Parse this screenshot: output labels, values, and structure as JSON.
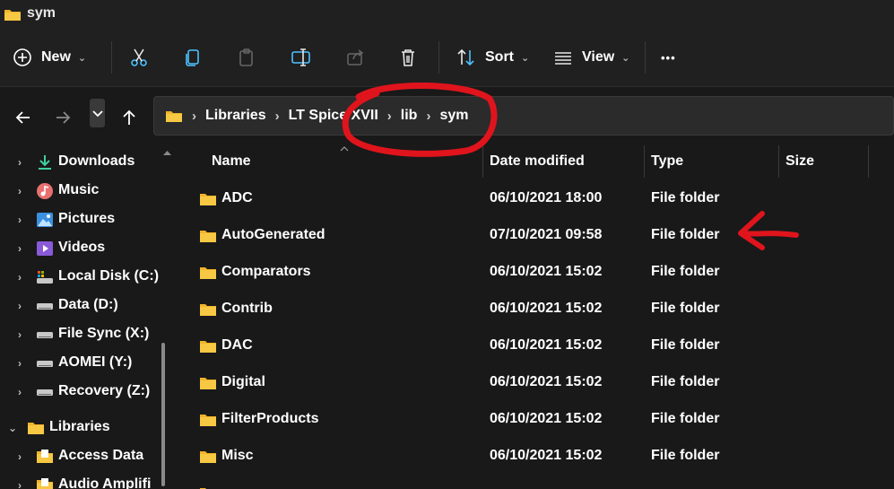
{
  "window": {
    "title": "sym"
  },
  "toolbar": {
    "new_label": "New",
    "sort_label": "Sort",
    "view_label": "View",
    "more_label": "•••"
  },
  "breadcrumb": {
    "items": [
      "Libraries",
      "LT Spice XVII",
      "lib",
      "sym"
    ]
  },
  "sidebar": {
    "items": [
      {
        "label": "Downloads",
        "icon": "download-icon"
      },
      {
        "label": "Music",
        "icon": "music-icon"
      },
      {
        "label": "Pictures",
        "icon": "pictures-icon"
      },
      {
        "label": "Videos",
        "icon": "videos-icon"
      },
      {
        "label": "Local Disk (C:)",
        "icon": "local-disk-icon"
      },
      {
        "label": "Data (D:)",
        "icon": "drive-icon"
      },
      {
        "label": "File Sync (X:)",
        "icon": "drive-icon"
      },
      {
        "label": "AOMEI (Y:)",
        "icon": "drive-icon"
      },
      {
        "label": "Recovery (Z:)",
        "icon": "drive-icon"
      },
      {
        "label": "Libraries",
        "icon": "library-folder-icon"
      },
      {
        "label": "Access Data",
        "icon": "library-folder-icon"
      },
      {
        "label": "Audio Amplifi",
        "icon": "library-folder-icon"
      }
    ]
  },
  "columns": {
    "name": "Name",
    "date": "Date modified",
    "type": "Type",
    "size": "Size"
  },
  "files": [
    {
      "name": "ADC",
      "date": "06/10/2021 18:00",
      "type": "File folder"
    },
    {
      "name": "AutoGenerated",
      "date": "07/10/2021 09:58",
      "type": "File folder"
    },
    {
      "name": "Comparators",
      "date": "06/10/2021 15:02",
      "type": "File folder"
    },
    {
      "name": "Contrib",
      "date": "06/10/2021 15:02",
      "type": "File folder"
    },
    {
      "name": "DAC",
      "date": "06/10/2021 15:02",
      "type": "File folder"
    },
    {
      "name": "Digital",
      "date": "06/10/2021 15:02",
      "type": "File folder"
    },
    {
      "name": "FilterProducts",
      "date": "06/10/2021 15:02",
      "type": "File folder"
    },
    {
      "name": "Misc",
      "date": "06/10/2021 15:02",
      "type": "File folder"
    }
  ],
  "colors": {
    "annotation": "#e0141c",
    "folder": "#f7c843",
    "accent": "#4cc2ff"
  }
}
